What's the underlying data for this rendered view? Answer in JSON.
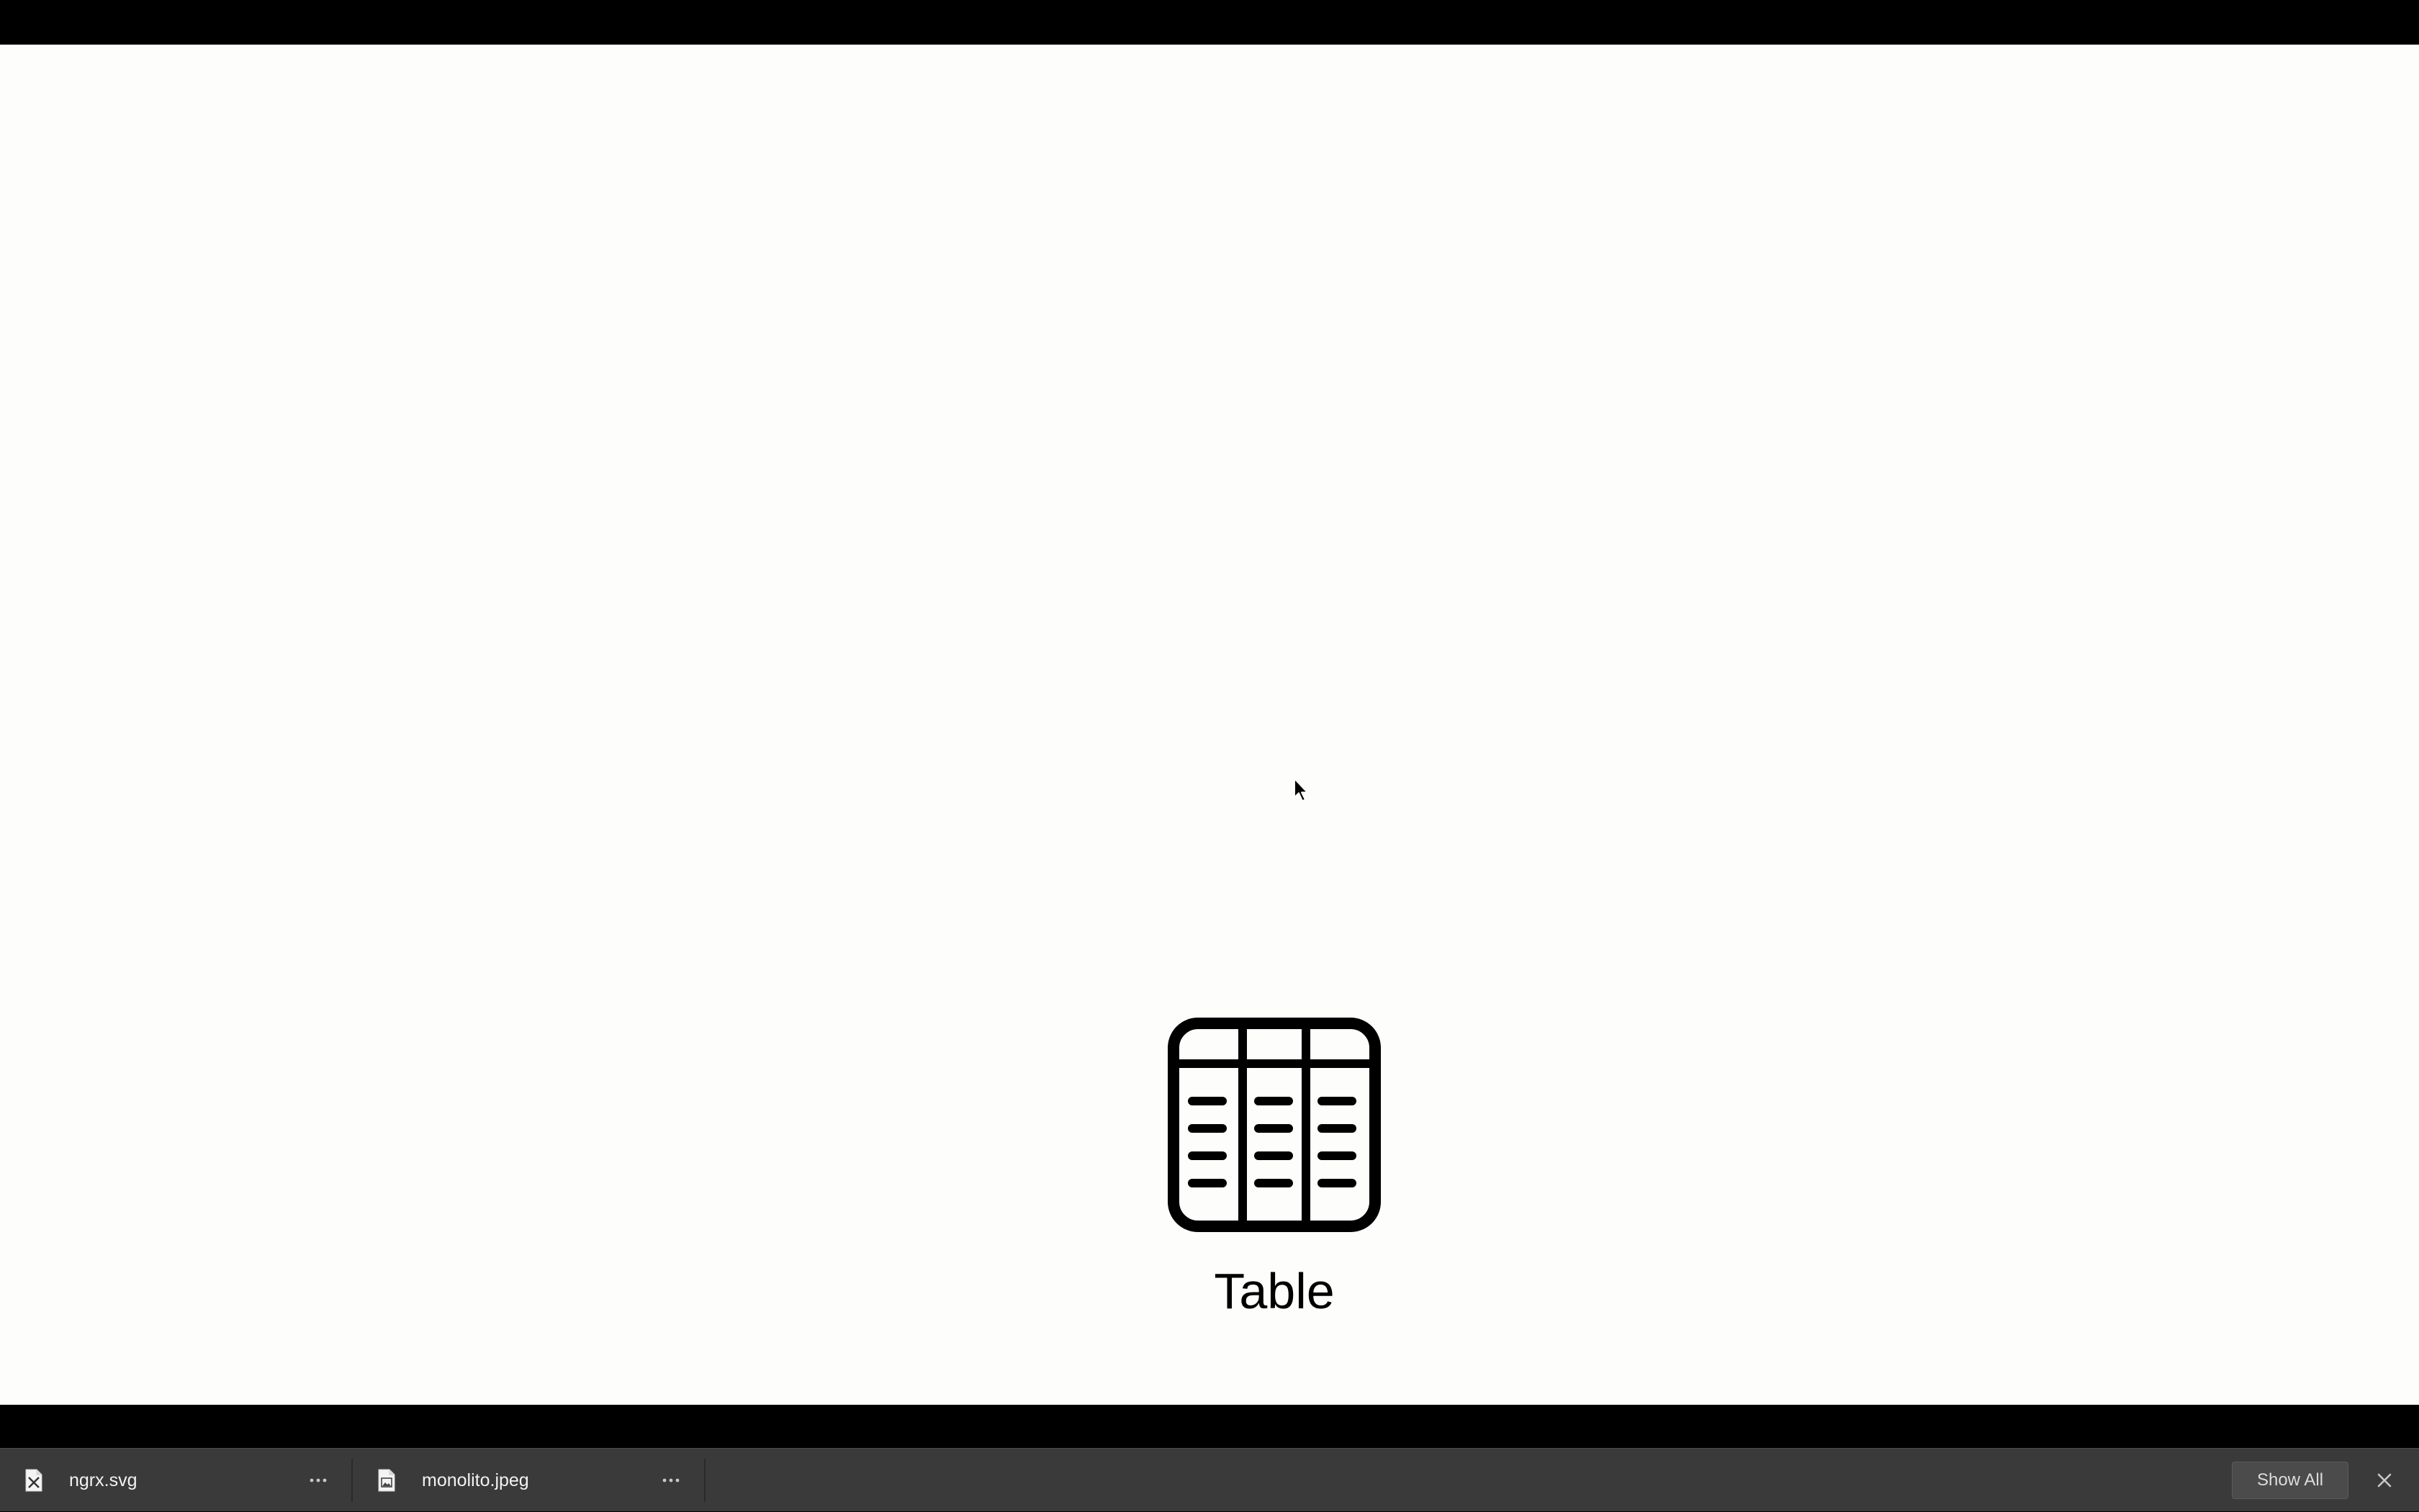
{
  "main": {
    "item_label": "Table",
    "item_icon": "table-icon"
  },
  "downloads": {
    "items": [
      {
        "name": "ngrx.svg",
        "icon": "svg-file-icon",
        "more": "···"
      },
      {
        "name": "monolito.jpeg",
        "icon": "image-file-icon",
        "more": "···"
      }
    ],
    "show_all_label": "Show All",
    "close_icon": "close-icon"
  }
}
